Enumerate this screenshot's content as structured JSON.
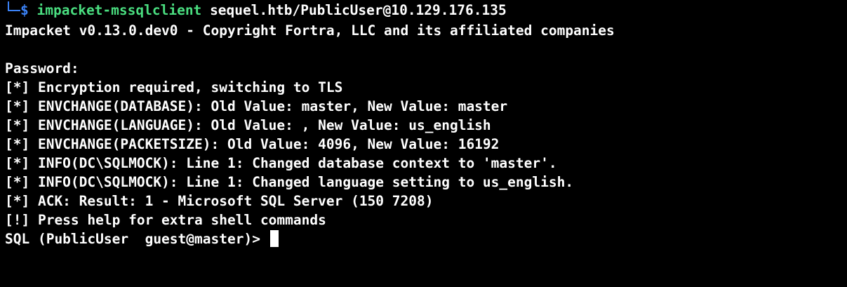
{
  "colors": {
    "background": "#000000",
    "text": "#ffffff",
    "prompt_accent": "#3b82f6",
    "command": "#4ade80"
  },
  "terminal": {
    "prompt_symbol": "$",
    "command_name": "impacket-mssqlclient",
    "command_args": "sequel.htb/PublicUser@10.129.176.135",
    "output_lines": [
      "Impacket v0.13.0.dev0 - Copyright Fortra, LLC and its affiliated companies",
      "",
      "Password:",
      "[*] Encryption required, switching to TLS",
      "[*] ENVCHANGE(DATABASE): Old Value: master, New Value: master",
      "[*] ENVCHANGE(LANGUAGE): Old Value: , New Value: us_english",
      "[*] ENVCHANGE(PACKETSIZE): Old Value: 4096, New Value: 16192",
      "[*] INFO(DC\\SQLMOCK): Line 1: Changed database context to 'master'.",
      "[*] INFO(DC\\SQLMOCK): Line 1: Changed language setting to us_english.",
      "[*] ACK: Result: 1 - Microsoft SQL Server (150 7208)",
      "[!] Press help for extra shell commands"
    ],
    "sql_prompt": "SQL (PublicUser  guest@master)> "
  }
}
